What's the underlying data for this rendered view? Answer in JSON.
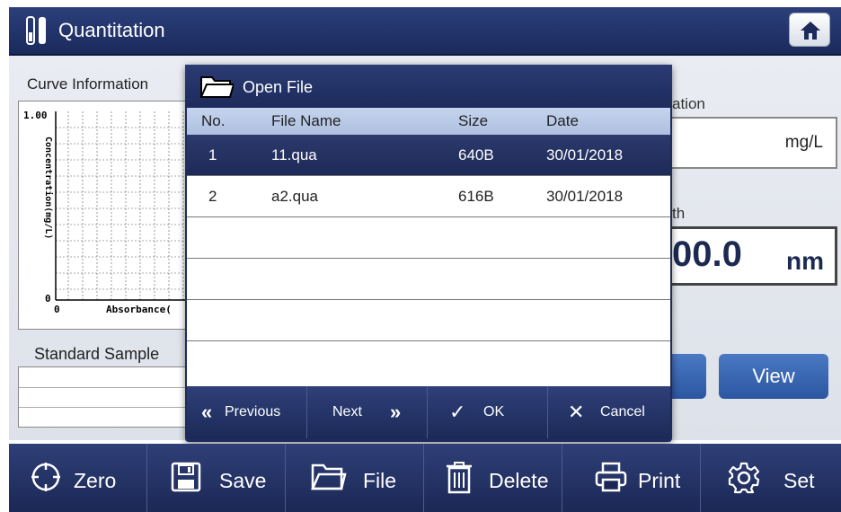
{
  "header": {
    "title": "Quantitation"
  },
  "curve_panel": {
    "title": "Curve Information",
    "y_axis_label": "Concentration(mg/L)",
    "y_max_label": "1.00",
    "y_min_label": "0",
    "x_min_label": "0",
    "x_axis_label": "Absorbance("
  },
  "standard_panel": {
    "title": "Standard Sample"
  },
  "right_panel": {
    "conc_label": "ation",
    "conc_unit": "mg/L",
    "wl_label": "th",
    "wl_value": "00.0",
    "wl_unit": "nm",
    "view_label": "View"
  },
  "dialog": {
    "title": "Open File",
    "columns": {
      "no": "No.",
      "name": "File Name",
      "size": "Size",
      "date": "Date"
    },
    "rows": [
      {
        "no": "1",
        "name": "11.qua",
        "size": "640B",
        "date": "30/01/2018",
        "selected": true
      },
      {
        "no": "2",
        "name": "a2.qua",
        "size": "616B",
        "date": "30/01/2018",
        "selected": false
      }
    ],
    "footer": {
      "previous_icon": "«",
      "previous_label": "Previous",
      "next_label": "Next",
      "next_icon": "»",
      "ok_icon": "✓",
      "ok_label": "OK",
      "cancel_icon": "✕",
      "cancel_label": "Cancel"
    }
  },
  "toolbar": {
    "zero_label": "Zero",
    "save_label": "Save",
    "file_label": "File",
    "delete_label": "Delete",
    "print_label": "Print",
    "set_label": "Set"
  },
  "colors": {
    "primary": "#1d2b5c",
    "selection": "#1d2a58",
    "header_blue": "#aec0e0",
    "button_blue": "#2c56a0"
  }
}
